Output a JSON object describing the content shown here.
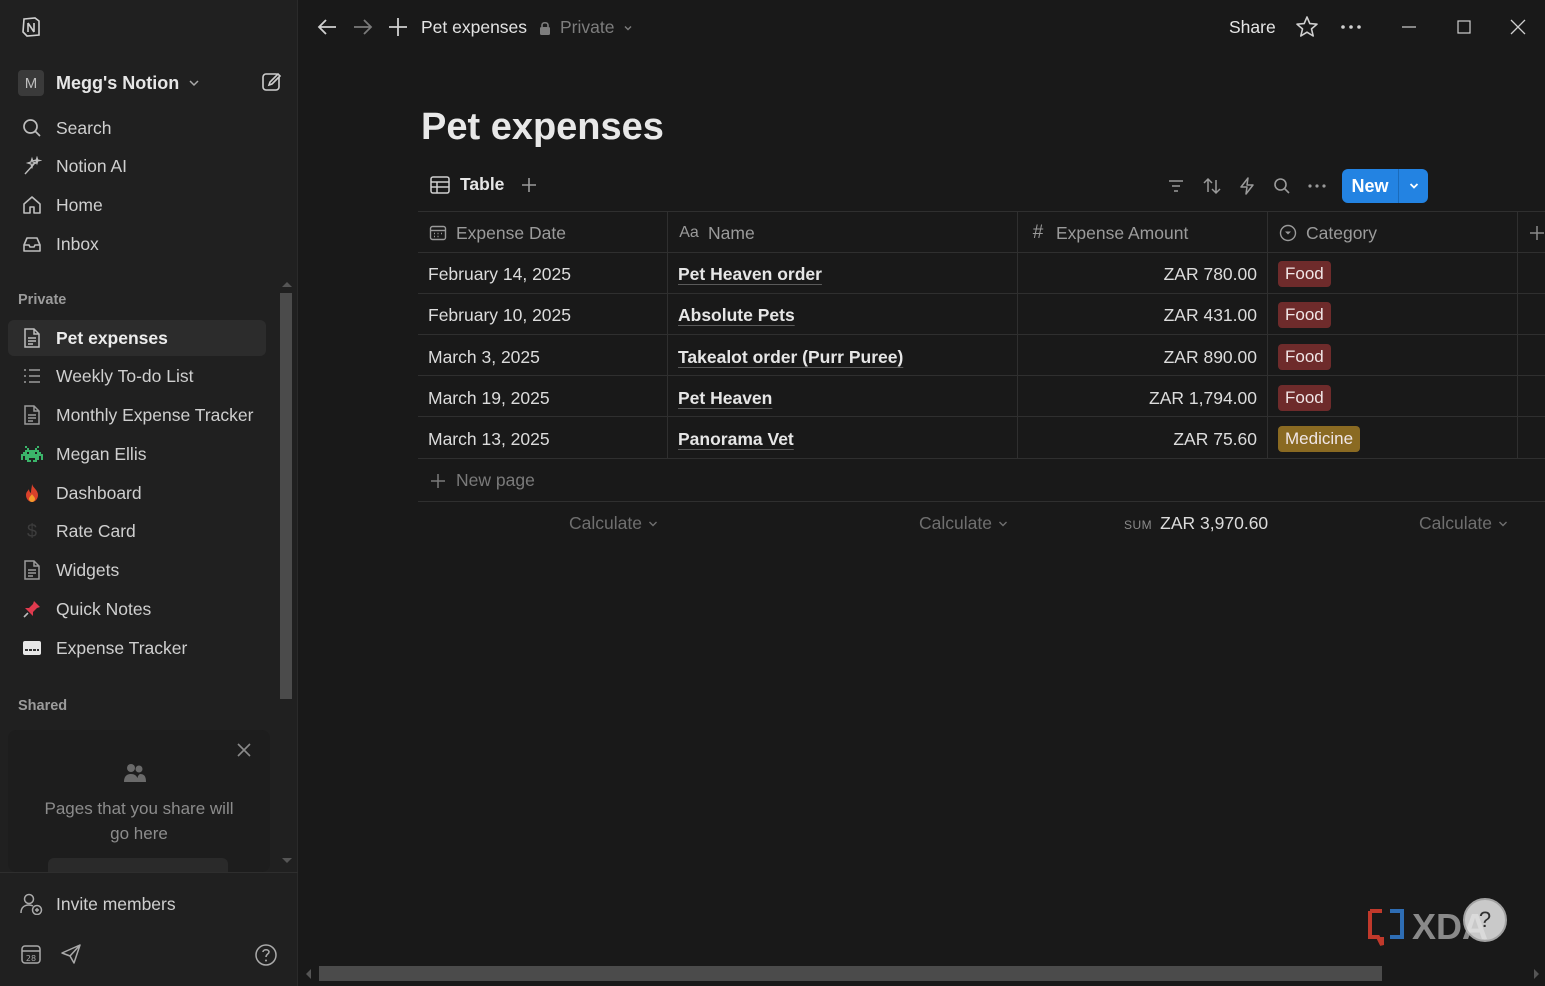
{
  "app": {
    "name": "Notion"
  },
  "workspace": {
    "avatar_letter": "M",
    "name": "Megg's Notion"
  },
  "nav": {
    "search": "Search",
    "notion_ai": "Notion AI",
    "home": "Home",
    "inbox": "Inbox"
  },
  "sections": {
    "private": "Private",
    "shared": "Shared"
  },
  "private_pages": [
    {
      "label": "Pet expenses",
      "icon": "page-icon",
      "active": true
    },
    {
      "label": "Weekly To-do List",
      "icon": "list-icon"
    },
    {
      "label": "Monthly Expense Tracker",
      "icon": "page-icon"
    },
    {
      "label": "Megan Ellis",
      "icon": "space-invader-icon"
    },
    {
      "label": "Dashboard",
      "icon": "fire-icon"
    },
    {
      "label": "Rate Card",
      "icon": "dollar-icon"
    },
    {
      "label": "Widgets",
      "icon": "page-icon"
    },
    {
      "label": "Quick Notes",
      "icon": "pushpin-icon"
    },
    {
      "label": "Expense Tracker",
      "icon": "card-icon"
    }
  ],
  "shared_card": {
    "text": "Pages that you share will go here"
  },
  "bottom": {
    "invite": "Invite members"
  },
  "topbar": {
    "breadcrumb": "Pet expenses",
    "privacy": "Private",
    "share": "Share"
  },
  "page": {
    "title": "Pet expenses",
    "view_name": "Table",
    "new_button": "New",
    "new_page": "New page"
  },
  "table": {
    "columns": [
      {
        "label": "Expense Date",
        "icon": "calendar-icon"
      },
      {
        "label": "Name",
        "icon": "text-aa-icon"
      },
      {
        "label": "Expense Amount",
        "icon": "hash-icon"
      },
      {
        "label": "Category",
        "icon": "select-icon"
      }
    ],
    "rows": [
      {
        "date": "February 14, 2025",
        "name": "Pet Heaven order",
        "amount": "ZAR 780.00",
        "category": "Food",
        "cat_color": "#6e2b2b"
      },
      {
        "date": "February 10, 2025",
        "name": "Absolute Pets",
        "amount": "ZAR 431.00",
        "category": "Food",
        "cat_color": "#6e2b2b"
      },
      {
        "date": "March 3, 2025",
        "name": "Takealot order (Purr Puree)",
        "amount": "ZAR 890.00",
        "category": "Food",
        "cat_color": "#6e2b2b"
      },
      {
        "date": "March 19, 2025",
        "name": "Pet Heaven",
        "amount": "ZAR 1,794.00",
        "category": "Food",
        "cat_color": "#6e2b2b"
      },
      {
        "date": "March 13, 2025",
        "name": "Panorama Vet",
        "amount": "ZAR 75.60",
        "category": "Medicine",
        "cat_color": "#8a6a22"
      }
    ],
    "footer": {
      "calc_label": "Calculate",
      "sum_label": "SUM",
      "sum_value": "ZAR 3,970.60"
    }
  },
  "watermark": {
    "text": "XDA"
  },
  "colors": {
    "accent": "#2383e2",
    "background": "#191919",
    "sidebar": "#202020"
  }
}
